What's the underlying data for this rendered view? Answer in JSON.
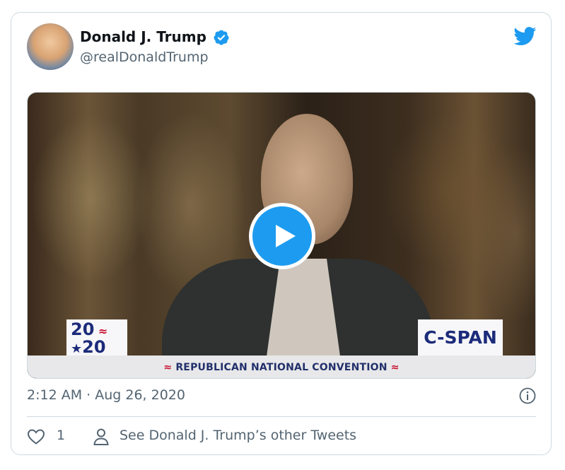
{
  "tweet": {
    "author_name": "Donald J. Trump",
    "handle": "@realDonaldTrump",
    "timestamp": "2:12 AM · Aug 26, 2020",
    "like_count": "1",
    "other_tweets_label": "See Donald J. Trump’s other Tweets"
  },
  "video": {
    "lower_third_text": "REPUBLICAN NATIONAL CONVENTION",
    "badge_top": "20",
    "badge_bottom": "20",
    "network": "C-SPAN"
  },
  "colors": {
    "accent": "#1d9bf0",
    "text_secondary": "#536471",
    "border": "#cfd9de"
  },
  "icons": [
    "verified-badge-icon",
    "twitter-bird-icon",
    "play-icon",
    "info-icon",
    "heart-icon",
    "person-icon"
  ]
}
